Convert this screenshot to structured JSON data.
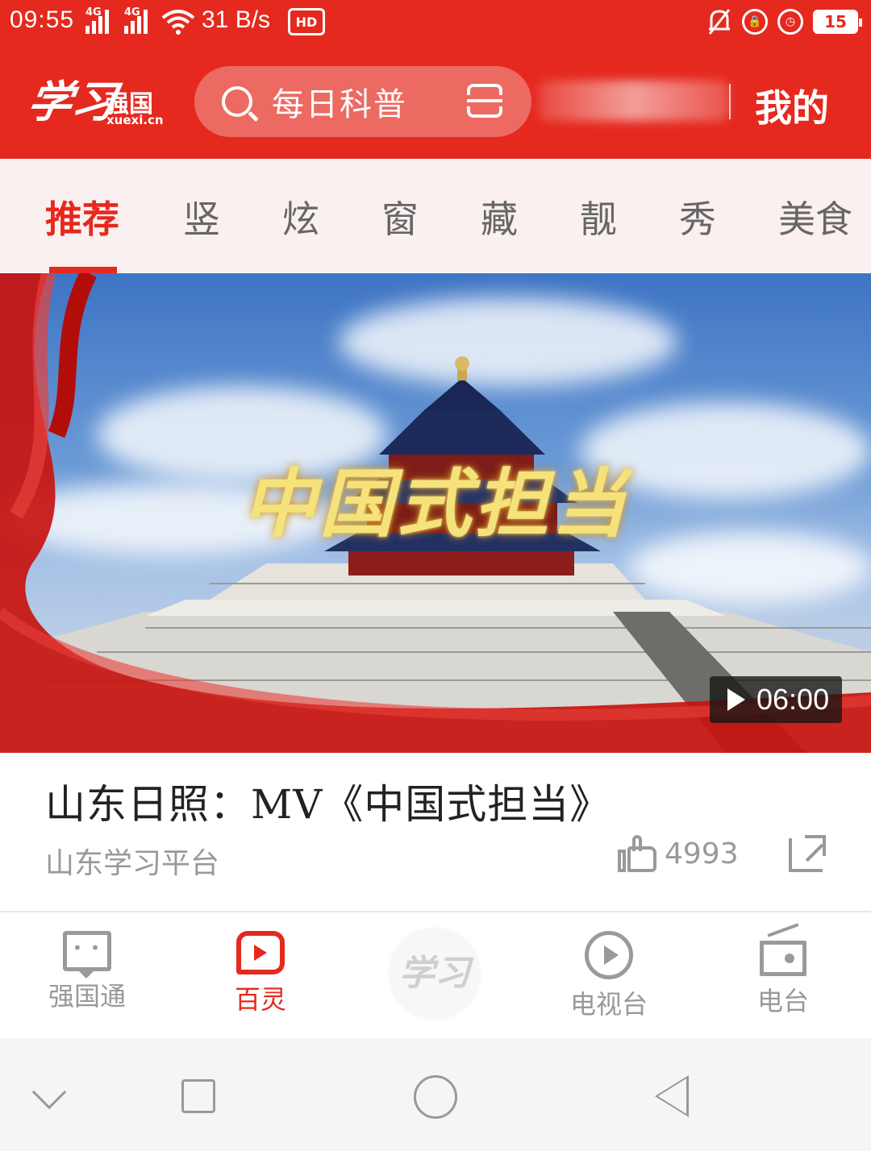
{
  "status_bar": {
    "time": "09:55",
    "net_tag_1": "4G",
    "net_tag_2": "4G",
    "speed": "31 B/s",
    "hd": "HD",
    "battery": "15"
  },
  "header": {
    "logo_calligraphy": "学习",
    "logo_text": "强国",
    "logo_url": "xuexi.cn",
    "search_placeholder": "每日科普",
    "mine_label": "我的"
  },
  "tabs": [
    {
      "label": "推荐",
      "active": true
    },
    {
      "label": "竖",
      "active": false
    },
    {
      "label": "炫",
      "active": false
    },
    {
      "label": "窗",
      "active": false
    },
    {
      "label": "藏",
      "active": false
    },
    {
      "label": "靓",
      "active": false
    },
    {
      "label": "秀",
      "active": false
    },
    {
      "label": "美食",
      "active": false
    }
  ],
  "hero": {
    "overlay_title": "中国式担当",
    "duration": "06:00"
  },
  "article": {
    "headline": "山东日照：MV《中国式担当》",
    "source": "山东学习平台",
    "likes": "4993"
  },
  "bottom_nav": [
    {
      "label": "强国通",
      "icon": "chat-bubble-icon",
      "active": false
    },
    {
      "label": "百灵",
      "icon": "bailing-play-icon",
      "active": true
    },
    {
      "label": "学习",
      "icon": "xuexi-logo-icon",
      "active": false
    },
    {
      "label": "电视台",
      "icon": "tv-play-icon",
      "active": false
    },
    {
      "label": "电台",
      "icon": "radio-icon",
      "active": false
    }
  ],
  "colors": {
    "brand_red": "#e5291f",
    "inactive_gray": "#999999"
  }
}
